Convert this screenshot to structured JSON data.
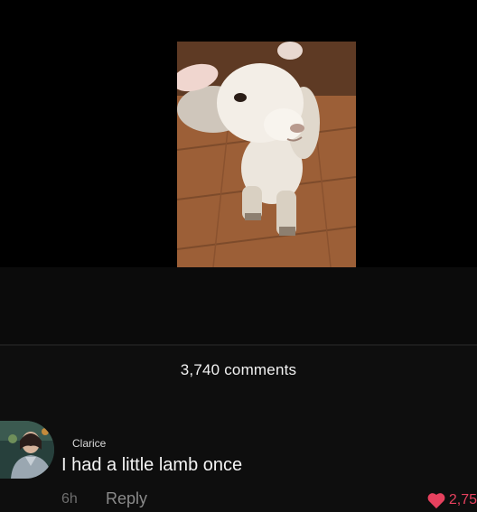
{
  "video": {
    "subject_icon": "lamb-video-frame"
  },
  "comments": {
    "count_label": "3,740 comments"
  },
  "comment": {
    "username": "Clarice",
    "text": "I had a little lamb once",
    "time": "6h",
    "reply_label": "Reply",
    "like_count": "2,75",
    "like_icon": "heart-icon",
    "like_color": "#e6415e"
  }
}
